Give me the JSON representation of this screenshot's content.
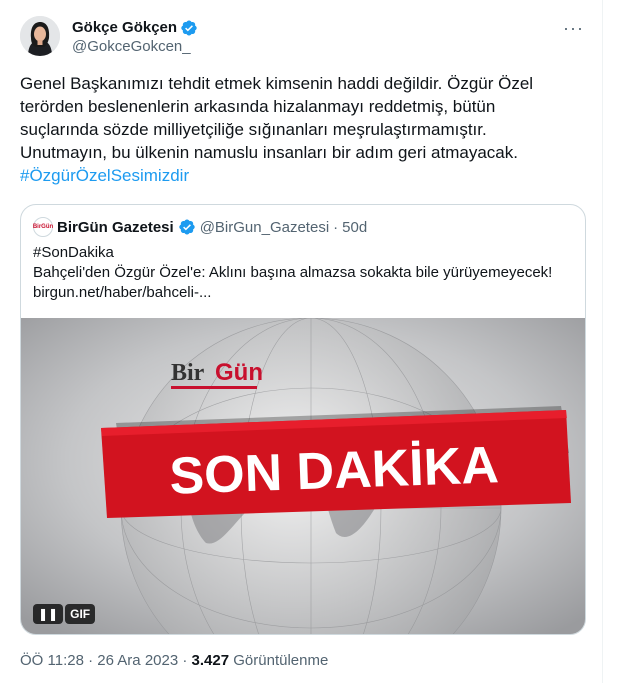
{
  "author": {
    "display_name": "Gökçe Gökçen",
    "handle": "@GokceGokcen_"
  },
  "more_label": "···",
  "tweet": {
    "text_lines": [
      "Genel Başkanımızı tehdit etmek kimsenin haddi değildir. Özgür Özel",
      "terörden beslenenlerin arkasında hizalanmayı reddetmiş, bütün",
      "suçlarında sözde milliyetçiliğe sığınanları meşrulaştırmamıştır.",
      "Unutmayın, bu ülkenin namuslu insanları bir adım geri atmayacak."
    ],
    "hashtag": "#ÖzgürÖzelSesimizdir"
  },
  "quote": {
    "logo_text": "BirGün",
    "name": "BirGün Gazetesi",
    "handle": "@BirGun_Gazetesi",
    "separator": "·",
    "age": "50d",
    "body_lines": [
      "#SonDakika",
      "Bahçeli'den Özgür Özel'e: Aklını başına almazsa sokakta bile yürüyemeyecek!",
      "birgun.net/haber/bahceli-..."
    ],
    "media": {
      "brand_prefix": "Bir",
      "brand_suffix": "Gün",
      "headline": "SON DAKİKA",
      "pause_label": "❚❚",
      "gif_label": "GIF"
    }
  },
  "meta": {
    "time": "ÖÖ 11:28",
    "date": "26 Ara 2023",
    "sep": "·",
    "views": "3.427",
    "views_label": "Görüntülenme"
  },
  "colors": {
    "accent": "#1d9bf0",
    "brand_red": "#c8102e",
    "banner_red": "#d2131f"
  }
}
